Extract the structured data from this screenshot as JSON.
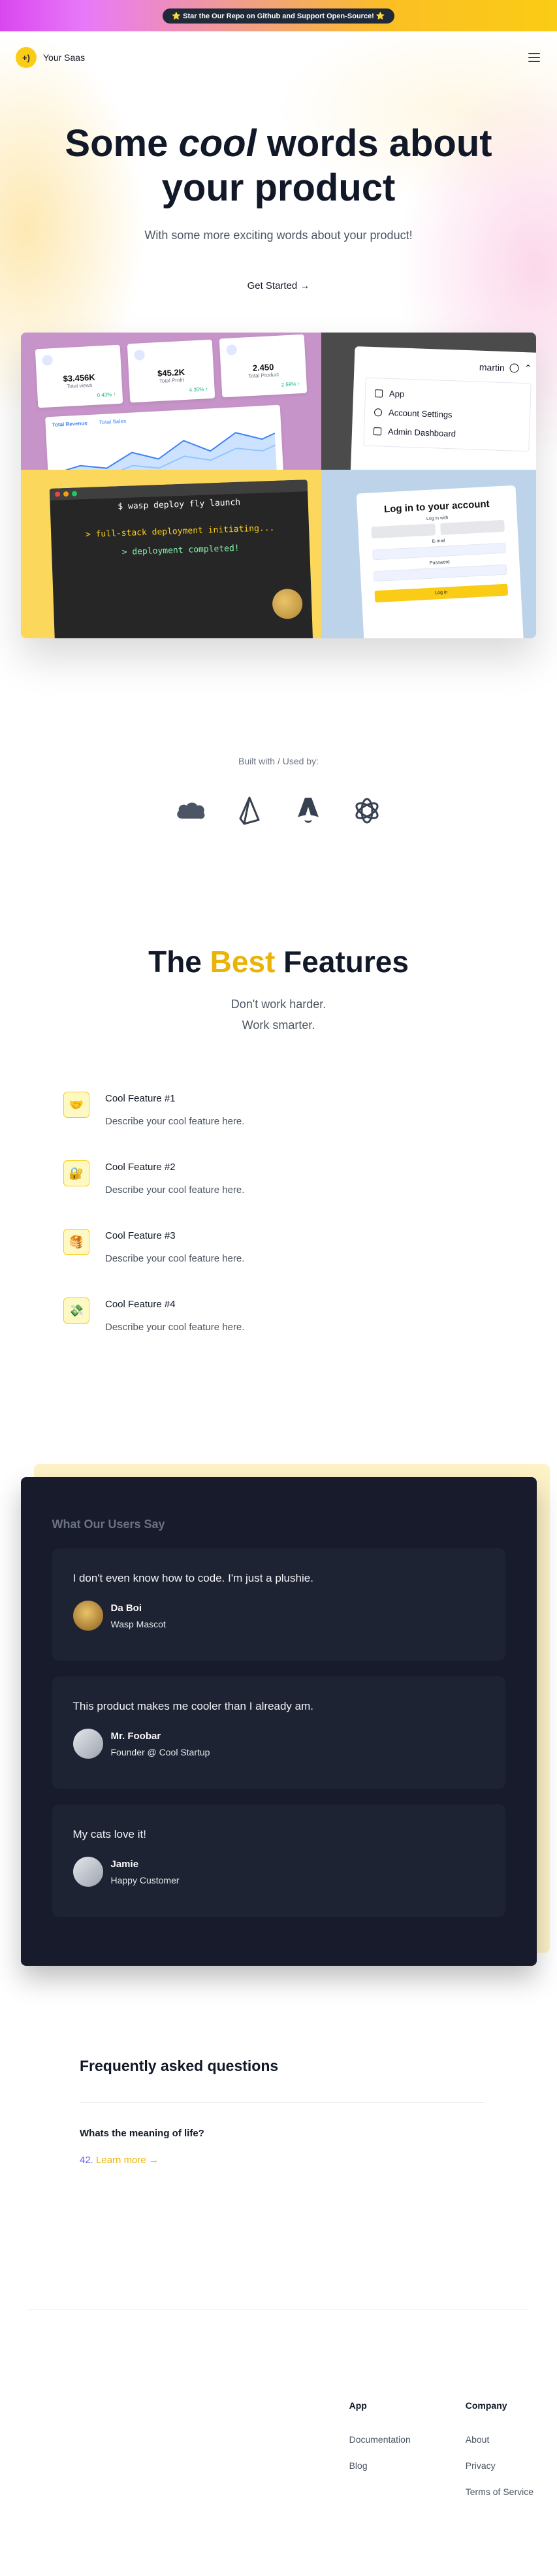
{
  "banner": {
    "text": "⭐️ Star the Our Repo on Github and Support Open-Source! ⭐️"
  },
  "nav": {
    "logo_text": "+)",
    "brand": "Your Saas"
  },
  "hero": {
    "title_before": "Some ",
    "title_em": "cool",
    "title_after": " words about your product",
    "subtitle": "With some more exciting words about your product!",
    "cta": "Get Started →"
  },
  "collage": {
    "stats": [
      {
        "value": "$3.456K",
        "label": "Total views",
        "pct": "0.43% ↑"
      },
      {
        "value": "$45.2K",
        "label": "Total Profit",
        "pct": "4.35% ↑"
      },
      {
        "value": "2.450",
        "label": "Total Product",
        "pct": "2.59% ↑"
      }
    ],
    "chart_legend": [
      "Total Revenue",
      "Total Sales"
    ],
    "menu_user": "martin",
    "menu_items": [
      "App",
      "Account Settings",
      "Admin Dashboard"
    ],
    "terminal": [
      "$ wasp deploy fly launch",
      "> full-stack deployment initiating...",
      "> deployment completed!"
    ],
    "login": {
      "title": "Log in to your account",
      "oauth": "Log in with",
      "email": "E-mail",
      "password": "Password",
      "button": "Log in"
    }
  },
  "built": {
    "title": "Built with / Used by:",
    "logos": [
      "salesforce-logo",
      "prisma-logo",
      "astro-logo",
      "openai-logo"
    ]
  },
  "features": {
    "title_before": "The ",
    "title_highlight": "Best",
    "title_after": " Features",
    "sub1": "Don't work harder.",
    "sub2": "Work smarter.",
    "items": [
      {
        "icon": "🤝",
        "name": "Cool Feature #1",
        "desc": "Describe your cool feature here."
      },
      {
        "icon": "🔐",
        "name": "Cool Feature #2",
        "desc": "Describe your cool feature here."
      },
      {
        "icon": "🥞",
        "name": "Cool Feature #3",
        "desc": "Describe your cool feature here."
      },
      {
        "icon": "💸",
        "name": "Cool Feature #4",
        "desc": "Describe your cool feature here."
      }
    ]
  },
  "testimonials": {
    "heading": "What Our Users Say",
    "items": [
      {
        "quote": "I don't even know how to code. I'm just a plushie.",
        "name": "Da Boi",
        "role": "Wasp Mascot"
      },
      {
        "quote": "This product makes me cooler than I already am.",
        "name": "Mr. Foobar",
        "role": "Founder @ Cool Startup"
      },
      {
        "quote": "My cats love it!",
        "name": "Jamie",
        "role": "Happy Customer"
      }
    ]
  },
  "faq": {
    "title": "Frequently asked questions",
    "question": "Whats the meaning of life?",
    "answer": "42.",
    "link": "Learn more →"
  },
  "footer": {
    "app": {
      "title": "App",
      "links": [
        "Documentation",
        "Blog"
      ]
    },
    "company": {
      "title": "Company",
      "links": [
        "About",
        "Privacy",
        "Terms of Service"
      ]
    }
  },
  "colors": {
    "accent": "#eab308",
    "dark_panel": "#171b2b",
    "banner_from": "#d946ef",
    "banner_to": "#facc15"
  }
}
